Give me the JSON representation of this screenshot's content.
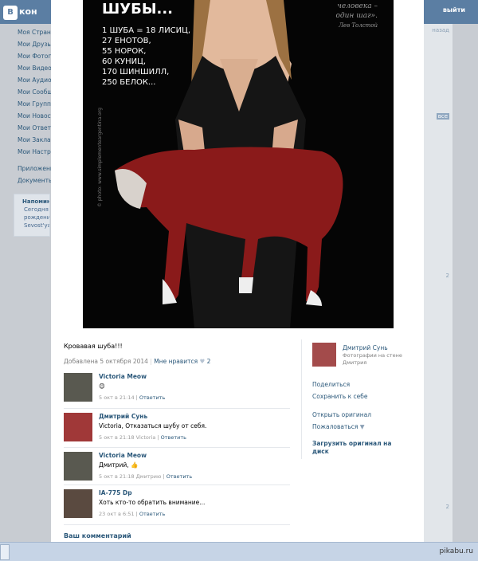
{
  "background": {
    "logo": "кон",
    "exit": "выйти",
    "menu": [
      "Моя Страница",
      "Мои Друзья",
      "Мои Фотографии",
      "Мои Видеозаписи",
      "Мои Аудиозаписи",
      "Мои Сообщения",
      "Мои Группы",
      "Мои Новости",
      "Мои Ответы",
      "Мои Закладки",
      "Мои Настройки"
    ],
    "apps": [
      "Приложения",
      "Документы"
    ],
    "reminder": {
      "title": "Напомина",
      "lines": [
        "Сегодня",
        "рождения",
        "Sevost'ya"
      ]
    },
    "right": {
      "back": "назад",
      "all": "все",
      "like1": "2",
      "like2": "2"
    }
  },
  "photo": {
    "headline": "ШУБЫ...",
    "lines": [
      "1 ШУБА = 18 ЛИСИЦ,",
      "27 ЕНОТОВ,",
      "55 НОРОК,",
      "60 КУНИЦ,",
      "170 ШИНШИЛЛ,",
      "250 БЕЛОК..."
    ],
    "quote": [
      "человека –",
      "один шаг».",
      "Лев Толстой"
    ],
    "credit": "© photo: www.simplementeargentina.org"
  },
  "caption": "Кровавая шуба!!!",
  "meta": {
    "added": "Добавлена 5 октября 2014",
    "like": "Мне нравится",
    "count": "2"
  },
  "comments": [
    {
      "name": "Victoria Meow",
      "text": "😊",
      "time": "5 окт в 21:14",
      "reply": "Ответить"
    },
    {
      "name": "Дмитрий Сунь",
      "text": "Victoria, Отказаться шубу от себя.",
      "time": "5 окт в 21:18 Victoria",
      "reply": "Ответить"
    },
    {
      "name": "Victoria Meow",
      "text": "Дмитрий, 👍",
      "time": "5 окт в 21:18 Дмитрию",
      "reply": "Ответить"
    },
    {
      "name": "IA-775 Dp",
      "text": "Хоть кто-то обратить внимание...",
      "time": "23 окт в 6:51",
      "reply": "Ответить"
    }
  ],
  "comment_label": "Ваш комментарий",
  "side": {
    "owner": "Дмитрий Сунь",
    "owner_sub": "Фотографии на стене Дмитрия",
    "share": "Поделиться",
    "save": "Сохранить к себе",
    "open": "Открыть оригинал",
    "report": "Пожаловаться",
    "download": "Загрузить оригинал на диск"
  },
  "taskbar": {
    "brand": "pikabu.ru"
  }
}
